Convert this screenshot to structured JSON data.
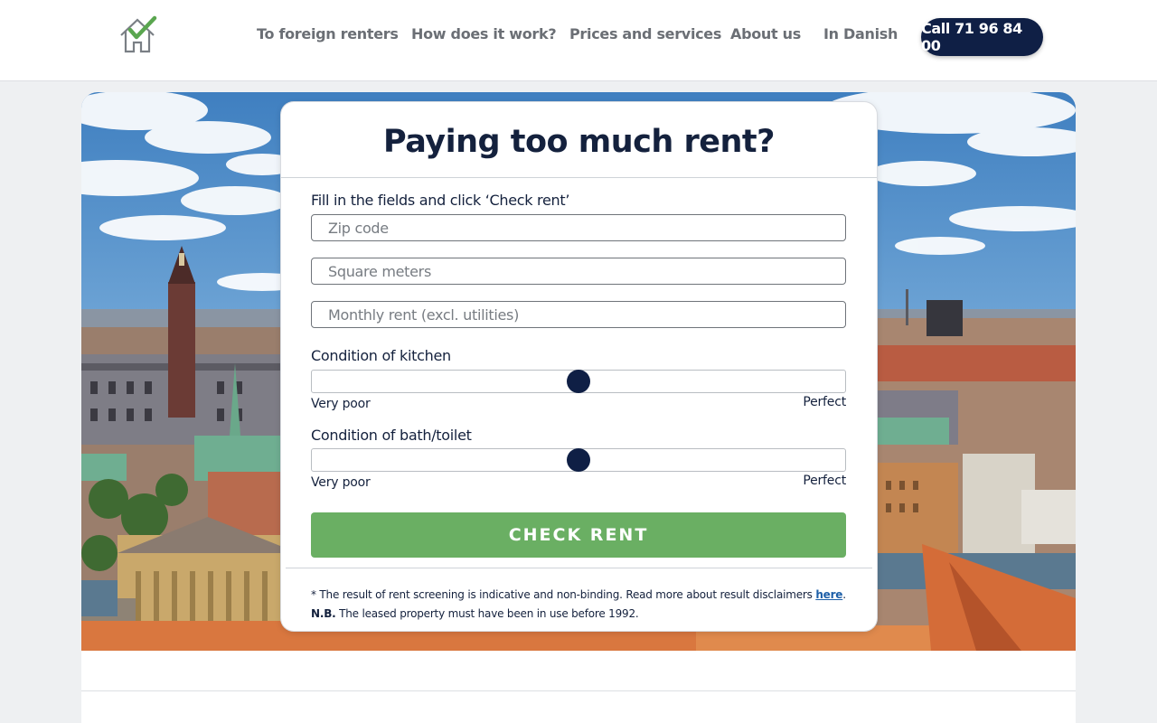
{
  "header": {
    "logo_alt": "logo",
    "nav": [
      {
        "label": "To foreign renters"
      },
      {
        "label": "How does it work?"
      },
      {
        "label": "Prices and services"
      },
      {
        "label": "About us"
      },
      {
        "label": "In Danish"
      }
    ],
    "call_button": "Call 71 96 84 00"
  },
  "form": {
    "title": "Paying too much rent?",
    "instructions": "Fill in the fields and click ‘Check rent’",
    "zip": {
      "placeholder": "Zip code",
      "value": ""
    },
    "sqm": {
      "placeholder": "Square meters",
      "value": ""
    },
    "rent": {
      "placeholder": "Monthly rent (excl. utilities)",
      "value": ""
    },
    "kitchen": {
      "label": "Condition of kitchen",
      "min_label": "Very poor",
      "max_label": "Perfect",
      "level": 0.5
    },
    "bath": {
      "label": "Condition of bath/toilet",
      "min_label": "Very poor",
      "max_label": "Perfect",
      "level": 0.5
    },
    "submit": "CHECK RENT",
    "disclaimer": {
      "text": "* The result of rent screening is indicative and non-binding. Read more about result disclaimers ",
      "link": "here",
      "after_link": ". ",
      "nb": "N.B.",
      "tail": " The leased property must have been in use before 1992."
    }
  },
  "colors": {
    "navy": "#0f1f45",
    "green_button": "#6aaf63",
    "logo_green": "#5aa64f",
    "link": "#1d5fa8"
  }
}
